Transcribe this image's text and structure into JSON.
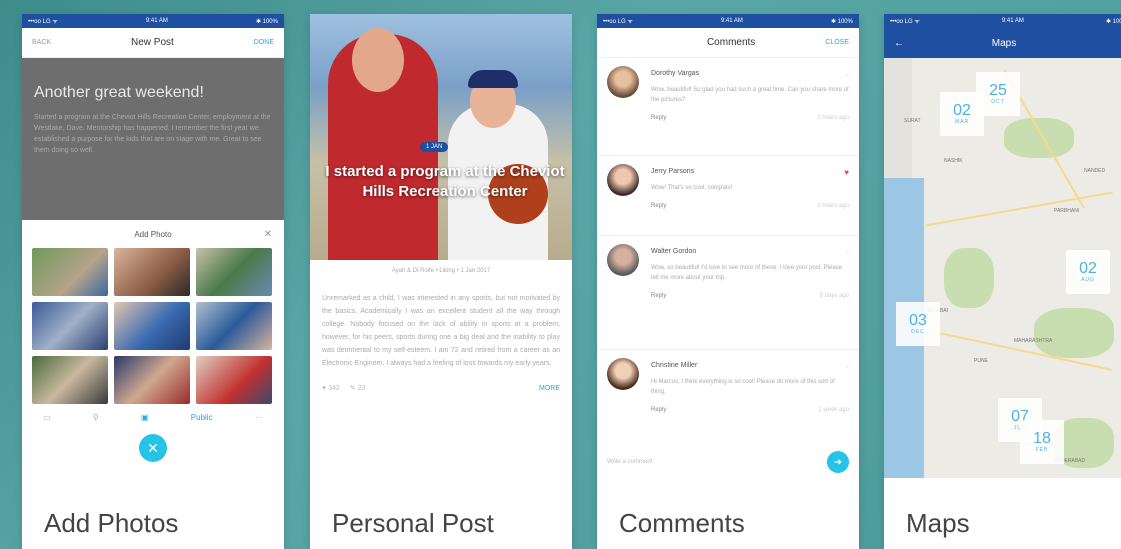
{
  "colors": {
    "brand_blue": "#1f4fa0",
    "accent_cyan": "#26c3e8",
    "link_blue": "#2aa6e6",
    "background_teal": "#4a9a9a"
  },
  "status": {
    "carrier": "•••oo LG ᯤ",
    "time": "9:41 AM",
    "battery": "✱ 100%"
  },
  "phone1": {
    "caption": "Add Photos",
    "nav": {
      "left": "BACK",
      "title": "New Post",
      "right": "DONE"
    },
    "draft_title": "Another great weekend!",
    "draft_body": "Started a program at the Cheviot Hills Recreation Center, employment at the Westlake, Dave. Mentorship has happened. I remember the first year we established a purpose for the kids that are on stage with me. Great to see them doing so well.",
    "sheet_title": "Add Photo",
    "sheet_close": "✕",
    "toolbar": {
      "camera": "▭",
      "location": "⚲",
      "photo": "▣",
      "visibility": "Public",
      "more": "···"
    },
    "fab": "✕",
    "photo_count": 9
  },
  "phone2": {
    "caption": "Personal Post",
    "badge": "1 JAN",
    "quote": "I started a program at the Cheviot Hills Recreation Center",
    "meta": "Ayah & Di Rolfe • Liking • 1 Jan 2017",
    "body": "Unremarked as a child, I was interested in any sports, but not motivated by the basics. Academically I was an excellent student all the way through college. Nobody focused on the lack of ability in sports at a problem; however, for his peers, sports during one a big deal and the inability to play was detrimental to my self-esteem. I am 72 and retired from a career as an Electronic Engineer. I always had a feeling of loss towards my early years.",
    "stats": {
      "likes": "♥ 342",
      "comments": "✎ 23",
      "more": "MORE"
    }
  },
  "phone3": {
    "caption": "Comments",
    "nav": {
      "title": "Comments",
      "right": "CLOSE"
    },
    "comments": [
      {
        "name": "Dorothy Vargas",
        "text": "Wow, beautiful! So glad you had such a great time. Can you share more of the pictures?",
        "reply": "Reply",
        "time": "2 hours ago",
        "icon": "◦"
      },
      {
        "name": "Jerry Parsons",
        "text": "Wow! That's so cool, congrats!",
        "reply": "Reply",
        "time": "3 hours ago",
        "icon": "♥"
      },
      {
        "name": "Walter Gordon",
        "text": "Wow, so beautiful! I'd love to see more of these. I love your post. Please tell me more about your trip.",
        "reply": "Reply",
        "time": "5 days ago",
        "icon": "◦"
      },
      {
        "name": "Christine Miller",
        "text": "Hi Marcus, I think everything is so cool! Please do more of this sort of thing.",
        "reply": "Reply",
        "time": "1 week ago",
        "icon": "◦"
      }
    ],
    "input_placeholder": "Write a comment",
    "send": "➜"
  },
  "phone4": {
    "caption": "Maps",
    "nav": {
      "back": "←",
      "title": "Maps"
    },
    "places": [
      "MUMBAI",
      "PUNE",
      "PARBHANI",
      "NANDED",
      "HYDERABAD",
      "MAHARASHTRA",
      "SURAT",
      "NASHIK"
    ],
    "markers": [
      {
        "day": "02",
        "month": "MAR"
      },
      {
        "day": "25",
        "month": "OCT"
      },
      {
        "day": "02",
        "month": "AUG"
      },
      {
        "day": "03",
        "month": "DEC"
      },
      {
        "day": "07",
        "month": "JUN"
      },
      {
        "day": "18",
        "month": "FEB"
      }
    ]
  }
}
